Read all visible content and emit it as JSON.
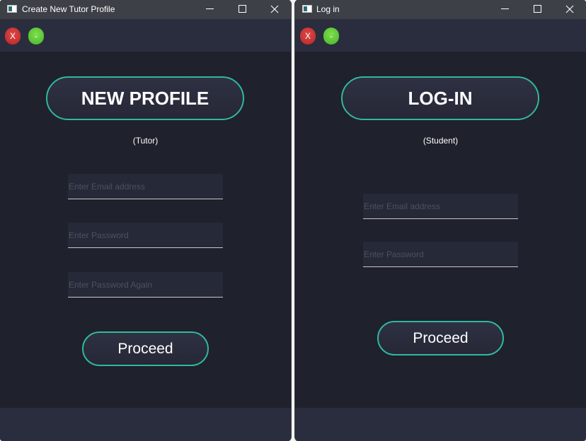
{
  "windows": {
    "left": {
      "title": "Create New Tutor Profile",
      "toolbar": {
        "close_label": "X",
        "minimize_label": "-"
      },
      "heading": "NEW PROFILE",
      "subtitle": "(Tutor)",
      "email_placeholder": "Enter Email address",
      "password_placeholder": "Enter Password",
      "password_again_placeholder": "Enter Password Again",
      "proceed_label": "Proceed"
    },
    "right": {
      "title": "Log in",
      "toolbar": {
        "close_label": "X",
        "minimize_label": "-"
      },
      "heading": "LOG-IN",
      "subtitle": "(Student)",
      "email_placeholder": "Enter Email address",
      "password_placeholder": "Enter Password",
      "proceed_label": "Proceed"
    }
  },
  "icons": {
    "app": "app-window-icon",
    "minimize": "minimize-icon",
    "maximize": "maximize-icon",
    "close": "close-icon"
  },
  "colors": {
    "background": "#1f212c",
    "bar": "#2a2d3e",
    "titlebar": "#3d4147",
    "accent": "#2fb8a0",
    "close_button": "#d13a3a",
    "minimize_button": "#5ec43a"
  }
}
